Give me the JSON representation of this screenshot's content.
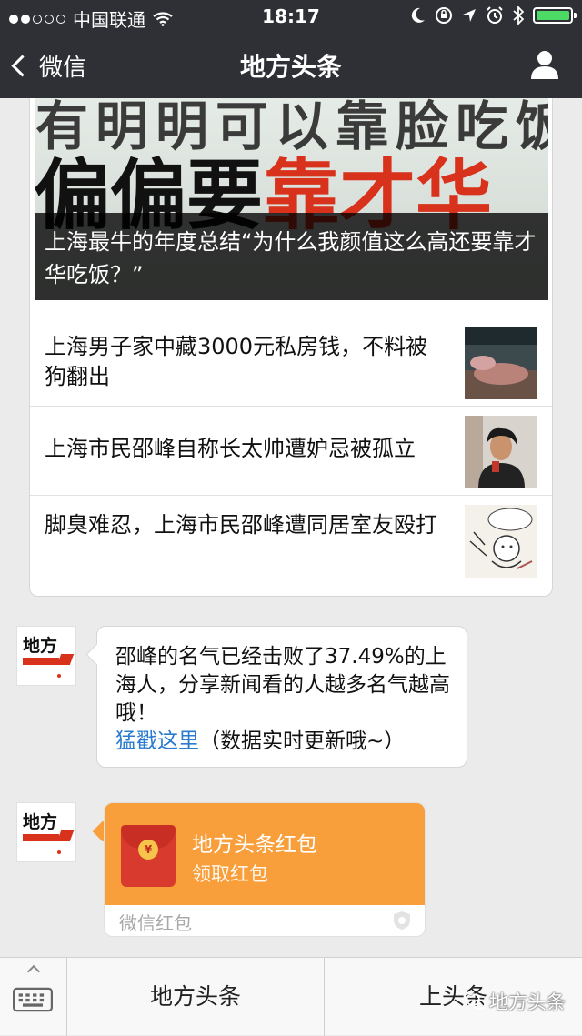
{
  "status_bar": {
    "carrier": "中国联通",
    "time": "18:17",
    "icons": [
      "moon-icon",
      "lock-rotation-icon",
      "location-icon",
      "alarm-icon",
      "bluetooth-icon",
      "battery-icon"
    ],
    "signal_dots_filled": 2,
    "signal_dots_total": 5
  },
  "nav": {
    "back_label": "微信",
    "title": "地方头条"
  },
  "article": {
    "hero_bg_text_1": "有明明可以靠脸吃饭",
    "hero_bg_text_2a": "偏偏要",
    "hero_bg_text_2b": "靠才华",
    "headline": "上海最牛的年度总结“为什么我颜值这么高还要靠才华吃饭？”",
    "items": [
      {
        "title": "上海男子家中藏3000元私房钱，不料被狗翻出"
      },
      {
        "title": "上海市民邵峰自称长太帅遭妒忌被孤立"
      },
      {
        "title": "脚臭难忍，上海市民邵峰遭同居室友殴打"
      }
    ]
  },
  "message": {
    "text": "邵峰的名气已经击败了37.49%的上海人，分享新闻看的人越多名气越高哦！",
    "link": "猛戳这里",
    "suffix": "（数据实时更新哦~）"
  },
  "avatar": {
    "logo_text": "地方"
  },
  "red_packet": {
    "title": "地方头条红包",
    "subtitle": "领取红包",
    "footer": "微信红包",
    "coin": "¥"
  },
  "bottom_menu": {
    "tab1": "地方头条",
    "tab2": "上头条",
    "watermark": "地方头条"
  },
  "colors": {
    "bar": "#2f3035",
    "red_packet": "#f89e3a",
    "link": "#2a7bcf",
    "accent_red": "#d8321c"
  }
}
